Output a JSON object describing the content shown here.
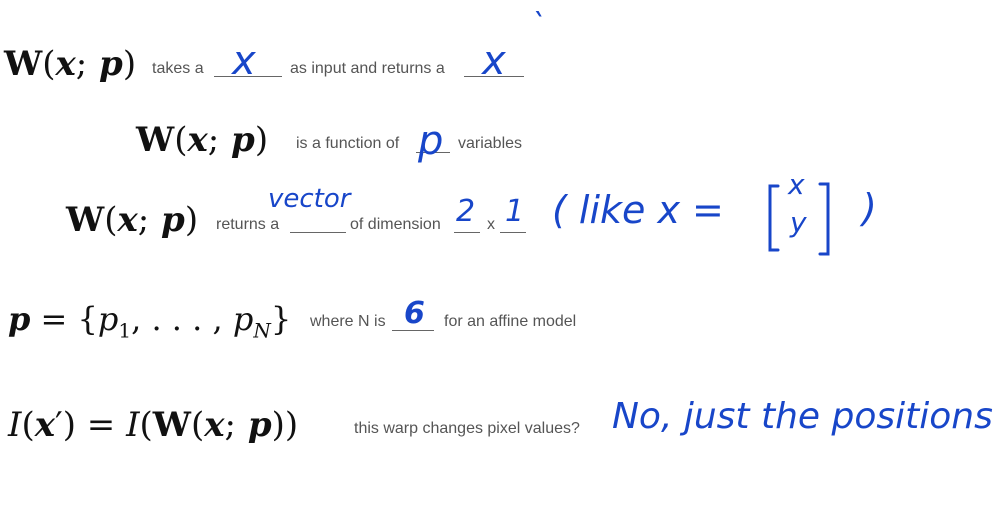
{
  "line1": {
    "math": "W(x; p)",
    "text_a": "takes a",
    "answer_a": "x",
    "text_b": "as input and returns a",
    "answer_b": "x",
    "answer_b_mark": "`"
  },
  "line2": {
    "math": "W(x; p)",
    "text_a": "is a function of",
    "answer_a": "p",
    "text_b": "variables"
  },
  "line3": {
    "math": "W(x; p)",
    "text_a": "returns a",
    "answer_a": "vector",
    "text_b": "of dimension",
    "answer_b": "2",
    "text_x": "x",
    "answer_c": "1",
    "note": "( like  x =",
    "vec_top": "x",
    "vec_bottom": "y",
    "note_close": ")"
  },
  "line4": {
    "math": "p = {p1, . . . , pN}",
    "text_a": "where N is",
    "answer_a": "6",
    "text_b": "for an affine model"
  },
  "line5": {
    "math": "I(x′) = I(W(x; p))",
    "text_a": "this warp changes pixel values?",
    "answer_a": "No, just the positions"
  },
  "colors": {
    "ink": "#1846c9",
    "text": "#555555",
    "math": "#111111"
  }
}
